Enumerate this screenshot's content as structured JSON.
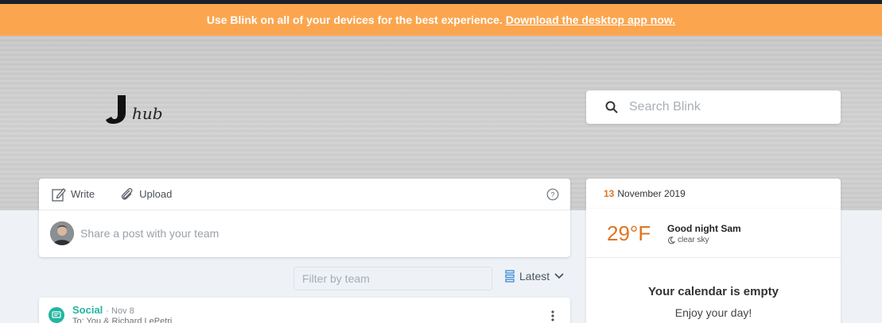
{
  "banner": {
    "message": "Use Blink on all of your devices for the best experience.",
    "link": "Download the desktop app now."
  },
  "header": {
    "logo_alt": "J hub",
    "search_placeholder": "Search Blink"
  },
  "composer": {
    "write_label": "Write",
    "upload_label": "Upload",
    "share_placeholder": "Share a post with your team"
  },
  "feed": {
    "filter_placeholder": "Filter by team",
    "sort_label": "Latest",
    "post": {
      "channel": "Social",
      "date": "· Nov 8",
      "to": "To: You & Richard LePetri"
    }
  },
  "sidebar": {
    "day": "13",
    "month_year": "November 2019",
    "temperature": "29°F",
    "greeting": "Good night Sam",
    "condition": "clear sky",
    "calendar_empty": "Your calendar is empty",
    "calendar_sub": "Enjoy your day!"
  },
  "colors": {
    "banner": "#fba64f",
    "accent_orange": "#e0741f",
    "social_green": "#23b5a0"
  },
  "icons": [
    "search-icon",
    "pencil-icon",
    "paperclip-icon",
    "help-icon",
    "sort-icon",
    "chevron-down-icon",
    "chat-icon",
    "kebab-icon",
    "moon-icon"
  ]
}
